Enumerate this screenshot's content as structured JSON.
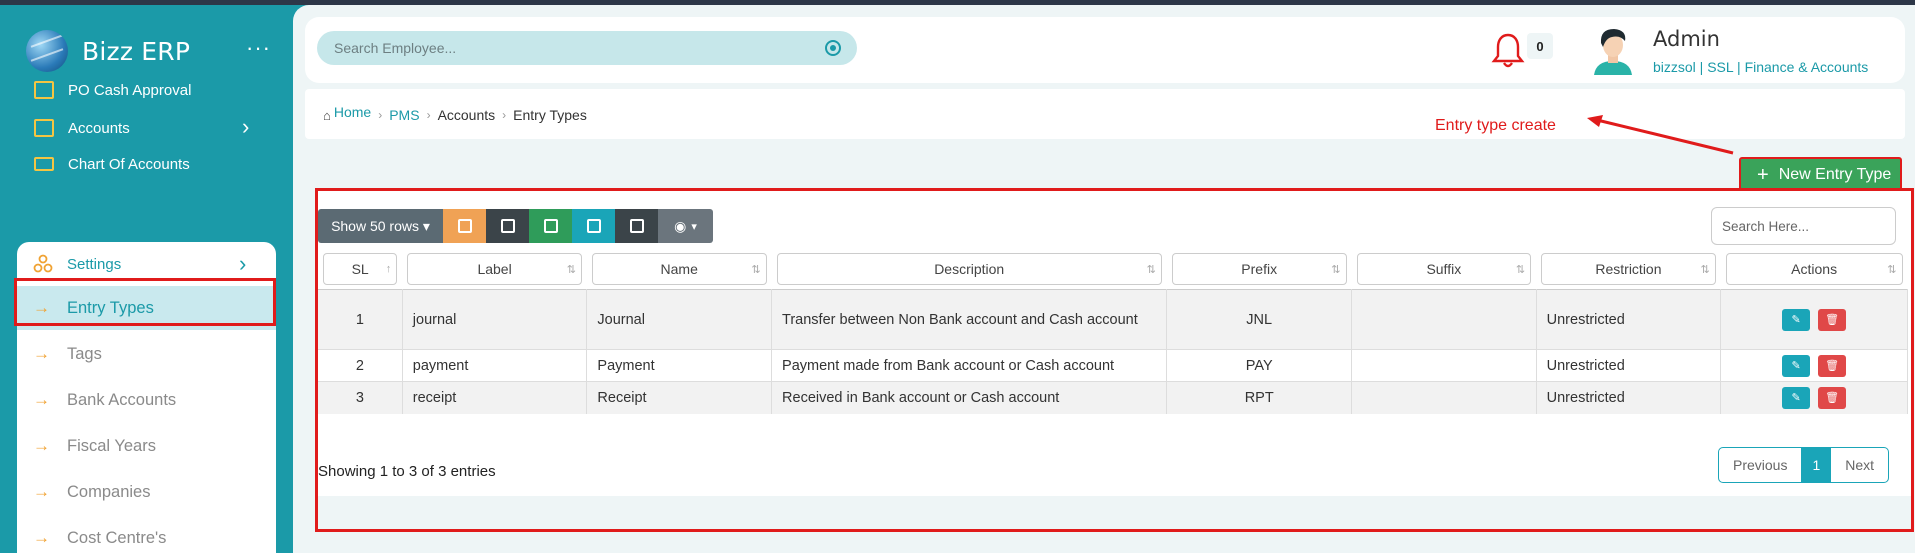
{
  "brand": {
    "name": "Bizz ERP",
    "menu_glyph": "···"
  },
  "sidebar": {
    "top_items": [
      {
        "label": "PO Cash Approval",
        "icon": "list-icon"
      },
      {
        "label": "Accounts",
        "icon": "clipboard-icon",
        "chevron": "›"
      },
      {
        "label": "Chart Of Accounts",
        "icon": "money-icon"
      }
    ],
    "settings": {
      "label": "Settings",
      "icon": "gear-icon",
      "chevron": "›"
    },
    "items": [
      {
        "label": "Entry Types",
        "active": true
      },
      {
        "label": "Tags"
      },
      {
        "label": "Bank Accounts"
      },
      {
        "label": "Fiscal Years"
      },
      {
        "label": "Companies"
      },
      {
        "label": "Cost Centre's"
      }
    ],
    "arrow": "→"
  },
  "header": {
    "search_placeholder": "Search Employee...",
    "notif_count": "0",
    "user_name": "Admin",
    "user_org": "bizzsol | SSL  | Finance & Accounts"
  },
  "breadcrumb": {
    "home": "Home",
    "pms": "PMS",
    "accounts": "Accounts",
    "current": "Entry Types",
    "sep": "›"
  },
  "annotation": {
    "text": "Entry type create"
  },
  "new_button": {
    "plus": "+",
    "label": "New Entry Type"
  },
  "toolbar": {
    "rows_label": "Show 50 rows ▾",
    "vis_caret": "▾"
  },
  "table_search": {
    "placeholder": "Search Here..."
  },
  "table": {
    "headers": [
      "SL",
      "Label",
      "Name",
      "Description",
      "Prefix",
      "Suffix",
      "Restriction",
      "Actions"
    ],
    "rows": [
      {
        "sl": "1",
        "label": "journal",
        "name": "Journal",
        "description": "Transfer between Non Bank account and Cash account",
        "prefix": "JNL",
        "suffix": "",
        "restriction": "Unrestricted"
      },
      {
        "sl": "2",
        "label": "payment",
        "name": "Payment",
        "description": "Payment made from Bank account or Cash account",
        "prefix": "PAY",
        "suffix": "",
        "restriction": "Unrestricted"
      },
      {
        "sl": "3",
        "label": "receipt",
        "name": "Receipt",
        "description": "Received in Bank account or Cash account",
        "prefix": "RPT",
        "suffix": "",
        "restriction": "Unrestricted"
      }
    ]
  },
  "footer": {
    "info": "Showing 1 to 3 of 3 entries",
    "prev": "Previous",
    "page": "1",
    "next": "Next"
  },
  "colors": {
    "teal": "#1b9aa8",
    "annotation_red": "#e01b1b",
    "green": "#3aa35a"
  }
}
